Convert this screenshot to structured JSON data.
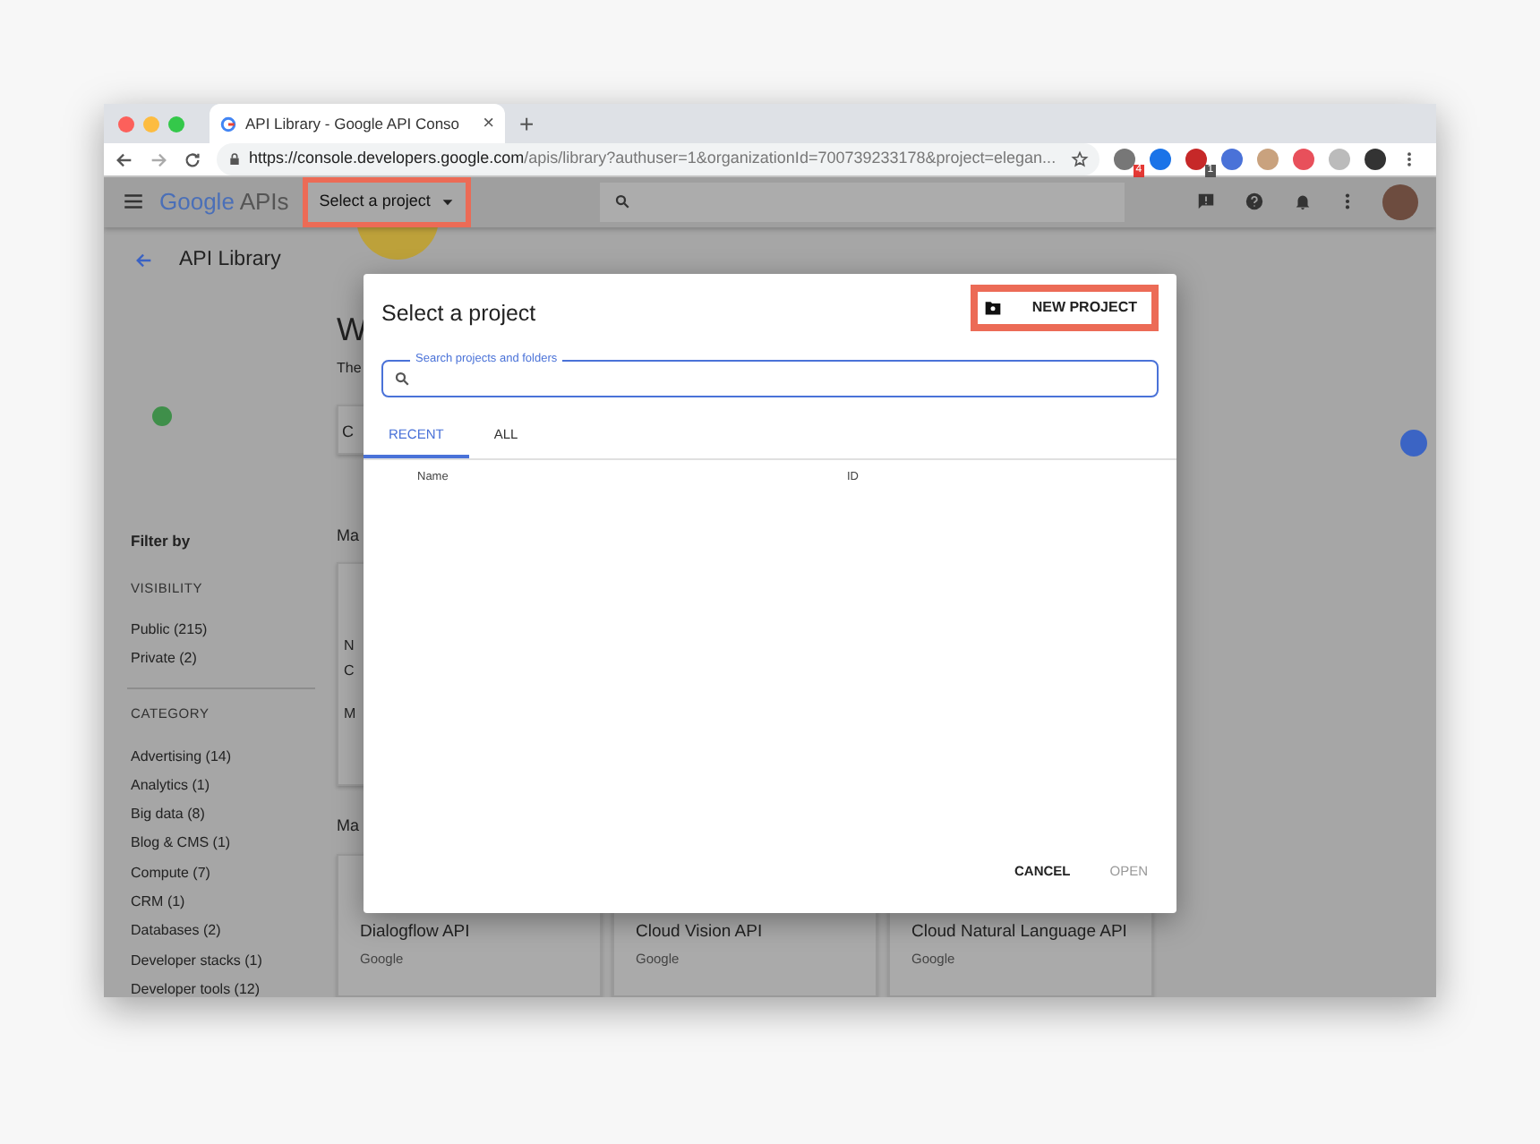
{
  "browser": {
    "tab_title": "API Library - Google API Conso",
    "tab_close": "×",
    "new_tab": "+",
    "url_host": "https://console.developers.google.com",
    "url_path": "/apis/library?authuser=1&organizationId=700739233178&project=elegan...",
    "extension_badges": [
      "4",
      "1"
    ]
  },
  "app_header": {
    "logo_google": "Google",
    "logo_apis": "APIs",
    "project_selector": "Select a project",
    "highlighted": true
  },
  "page": {
    "title": "API Library"
  },
  "sidebar": {
    "heading": "Filter by",
    "sections": [
      {
        "heading": "VISIBILITY",
        "items": [
          "Public (215)",
          "Private (2)"
        ]
      },
      {
        "heading": "CATEGORY",
        "items": [
          "Advertising (14)",
          "Analytics (1)",
          "Big data (8)",
          "Blog & CMS (1)",
          "Compute (7)",
          "CRM (1)",
          "Databases (2)",
          "Developer stacks (1)",
          "Developer tools (12)"
        ]
      }
    ]
  },
  "main": {
    "welcome": "W",
    "subtitle": "The",
    "stub_button": "C",
    "sections": [
      "Ma",
      "Ma"
    ],
    "featured_card": [
      "N",
      "C",
      "M"
    ],
    "cards": [
      {
        "title": "Dialogflow API",
        "vendor": "Google"
      },
      {
        "title": "Cloud Vision API",
        "vendor": "Google"
      },
      {
        "title": "Cloud Natural Language API",
        "vendor": "Google"
      }
    ]
  },
  "dialog": {
    "title": "Select a project",
    "new_project": {
      "label": "NEW PROJECT",
      "highlighted": true
    },
    "search": {
      "label": "Search projects and folders"
    },
    "tabs": [
      {
        "label": "RECENT",
        "selected": true
      },
      {
        "label": "ALL",
        "selected": false
      }
    ],
    "columns": [
      "Name",
      "ID"
    ],
    "buttons": [
      {
        "label": "CANCEL",
        "disabled": false
      },
      {
        "label": "OPEN",
        "disabled": true
      }
    ]
  }
}
